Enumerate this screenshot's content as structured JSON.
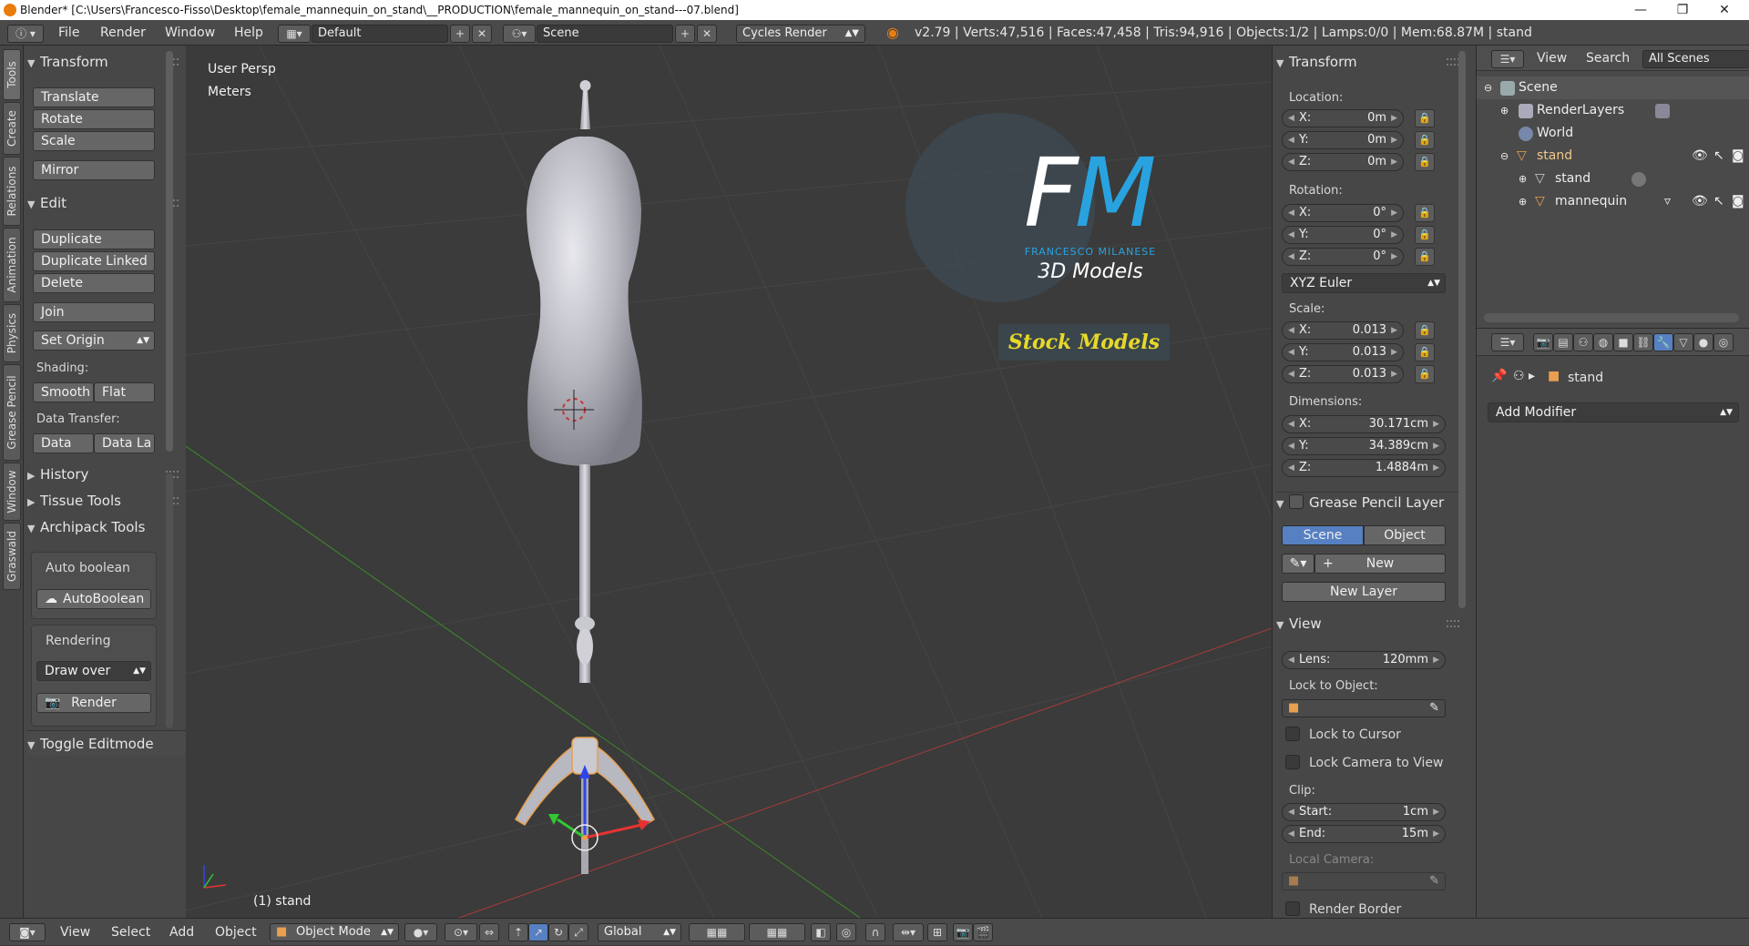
{
  "window": {
    "title": "Blender* [C:\\Users\\Francesco-Fisso\\Desktop\\female_mannequin_on_stand\\__PRODUCTION\\female_mannequin_on_stand---07.blend]",
    "minimize": "—",
    "restore": "❐",
    "close": "✕"
  },
  "menu": {
    "file": "File",
    "render": "Render",
    "window": "Window",
    "help": "Help"
  },
  "header": {
    "layout": "Default",
    "scene": "Scene",
    "engine": "Cycles Render",
    "info": "v2.79 | Verts:47,516 | Faces:47,458 | Tris:94,916 | Objects:1/2 | Lamps:0/0 | Mem:68.87M | stand"
  },
  "tabs": [
    "Tools",
    "Create",
    "Relations",
    "Animation",
    "Physics",
    "Grease Pencil",
    "Window",
    "Graswald"
  ],
  "toolshelf": {
    "transform_title": "Transform",
    "translate": "Translate",
    "rotate": "Rotate",
    "scale": "Scale",
    "mirror": "Mirror",
    "edit_title": "Edit",
    "duplicate": "Duplicate",
    "duplicate_linked": "Duplicate Linked",
    "delete": "Delete",
    "join": "Join",
    "set_origin": "Set Origin",
    "shading_label": "Shading:",
    "smooth": "Smooth",
    "flat": "Flat",
    "data_transfer_label": "Data Transfer:",
    "data": "Data",
    "data_la": "Data La",
    "history": "History",
    "tissue": "Tissue Tools",
    "archipack": "Archipack Tools",
    "auto_boolean_label": "Auto boolean",
    "auto_boolean_btn": "AutoBoolean",
    "rendering_label": "Rendering",
    "draw_over": "Draw over",
    "render_btn": "Render",
    "toggle_editmode": "Toggle Editmode"
  },
  "viewport": {
    "persp": "User Persp",
    "units": "Meters",
    "object_label": "(1) stand",
    "logo_fm_f": "F",
    "logo_fm_m": "M",
    "logo_name": "FRANCESCO MILANESE",
    "logo_sub": "3D Models",
    "stock": "Stock Models"
  },
  "npanel": {
    "transform_title": "Transform",
    "location_label": "Location:",
    "location": [
      {
        "k": "X:",
        "v": "0m"
      },
      {
        "k": "Y:",
        "v": "0m"
      },
      {
        "k": "Z:",
        "v": "0m"
      }
    ],
    "rotation_label": "Rotation:",
    "rotation": [
      {
        "k": "X:",
        "v": "0°"
      },
      {
        "k": "Y:",
        "v": "0°"
      },
      {
        "k": "Z:",
        "v": "0°"
      }
    ],
    "rotation_mode": "XYZ Euler",
    "scale_label": "Scale:",
    "scale": [
      {
        "k": "X:",
        "v": "0.013"
      },
      {
        "k": "Y:",
        "v": "0.013"
      },
      {
        "k": "Z:",
        "v": "0.013"
      }
    ],
    "dimensions_label": "Dimensions:",
    "dimensions": [
      {
        "k": "X:",
        "v": "30.171cm"
      },
      {
        "k": "Y:",
        "v": "34.389cm"
      },
      {
        "k": "Z:",
        "v": "1.4884m"
      }
    ],
    "gp_title": "Grease Pencil Layer",
    "gp_scene": "Scene",
    "gp_object": "Object",
    "gp_new": "New",
    "gp_new_layer": "New Layer",
    "view_title": "View",
    "lens_key": "Lens:",
    "lens_val": "120mm",
    "lock_object_label": "Lock to Object:",
    "lock_cursor": "Lock to Cursor",
    "lock_camera": "Lock Camera to View",
    "clip_label": "Clip:",
    "clip_start_key": "Start:",
    "clip_start_val": "1cm",
    "clip_end_key": "End:",
    "clip_end_val": "15m",
    "local_camera_label": "Local Camera:",
    "render_border": "Render Border"
  },
  "outliner": {
    "view": "View",
    "search": "Search",
    "filter": "All Scenes",
    "rows": [
      "Scene",
      "RenderLayers",
      "World",
      "stand",
      "stand",
      "mannequin"
    ]
  },
  "properties": {
    "object_name": "stand",
    "add_modifier": "Add Modifier"
  },
  "bottom": {
    "view": "View",
    "select": "Select",
    "add": "Add",
    "object": "Object",
    "mode": "Object Mode",
    "orientation": "Global"
  }
}
